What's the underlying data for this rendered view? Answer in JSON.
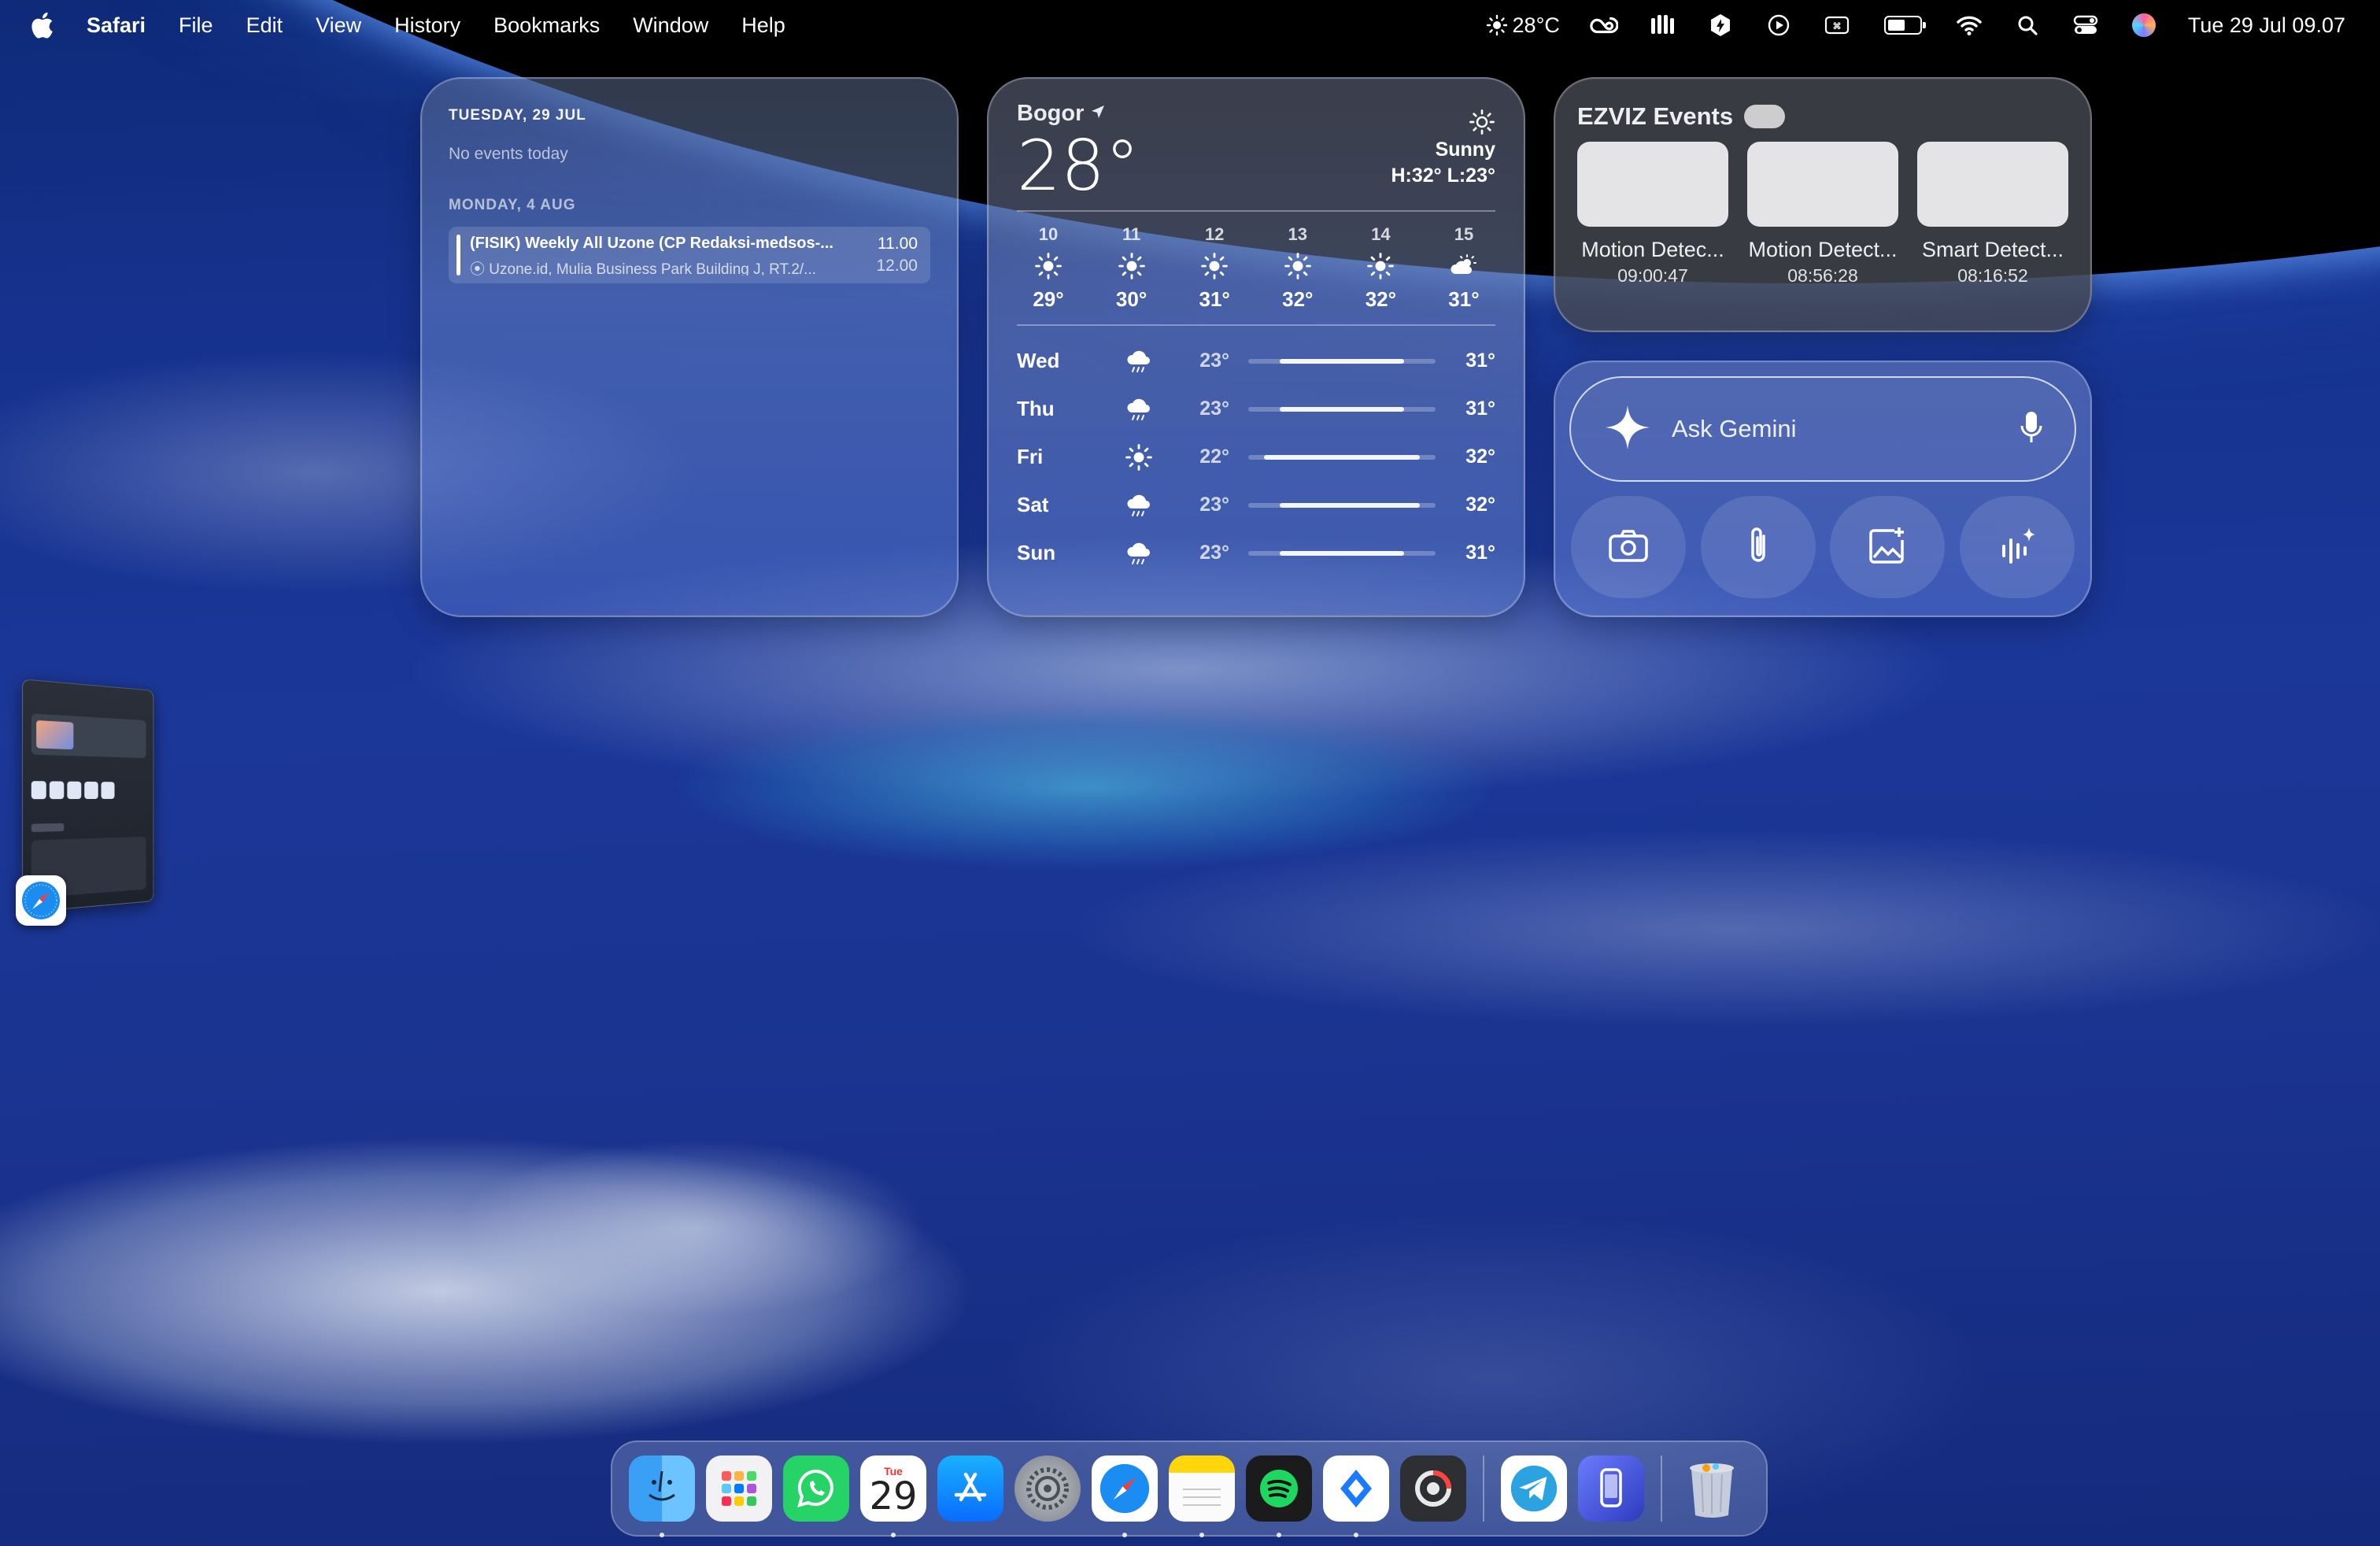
{
  "menubar": {
    "app_name": "Safari",
    "menus": [
      "File",
      "Edit",
      "View",
      "History",
      "Bookmarks",
      "Window",
      "Help"
    ],
    "weather": "28°C",
    "datetime": "Tue 29 Jul 09.07",
    "battery_level": 0.55,
    "status_icons": [
      "sun-icon",
      "creative-cloud-icon",
      "menu-app-icon",
      "vpn-icon",
      "play-icon",
      "input-source-icon",
      "battery-icon",
      "wifi-icon",
      "search-icon",
      "control-center-icon",
      "siri-icon"
    ]
  },
  "calendar": {
    "today_header": "TUESDAY, 29 JUL",
    "no_events": "No events today",
    "next_header": "MONDAY, 4 AUG",
    "event": {
      "title": "(FISIK) Weekly All Uzone (CP Redaksi-medsos-...",
      "location": "Uzone.id, Mulia Business Park Building J, RT.2/...",
      "start": "11.00",
      "end": "12.00"
    }
  },
  "weather": {
    "city": "Bogor",
    "temp": "28°",
    "condition": "Sunny",
    "high_low": "H:32° L:23°",
    "hourly": [
      {
        "hour": "10",
        "icon": "sun",
        "temp": "29°"
      },
      {
        "hour": "11",
        "icon": "sun",
        "temp": "30°"
      },
      {
        "hour": "12",
        "icon": "sun",
        "temp": "31°"
      },
      {
        "hour": "13",
        "icon": "sun",
        "temp": "32°"
      },
      {
        "hour": "14",
        "icon": "sun",
        "temp": "32°"
      },
      {
        "hour": "15",
        "icon": "partly-cloudy",
        "temp": "31°"
      }
    ],
    "daily": [
      {
        "day": "Wed",
        "icon": "rain",
        "low": "23°",
        "high": "31°"
      },
      {
        "day": "Thu",
        "icon": "rain",
        "low": "23°",
        "high": "31°"
      },
      {
        "day": "Fri",
        "icon": "sun",
        "low": "22°",
        "high": "32°"
      },
      {
        "day": "Sat",
        "icon": "rain",
        "low": "23°",
        "high": "32°"
      },
      {
        "day": "Sun",
        "icon": "rain",
        "low": "23°",
        "high": "31°"
      }
    ]
  },
  "ezviz": {
    "title": "EZVIZ Events",
    "events": [
      {
        "label": "Motion Detec...",
        "time": "09:00:47"
      },
      {
        "label": "Motion Detect...",
        "time": "08:56:28"
      },
      {
        "label": "Smart Detect...",
        "time": "08:16:52"
      }
    ]
  },
  "gemini": {
    "placeholder": "Ask Gemini",
    "actions": [
      "camera-icon",
      "attach-icon",
      "add-image-icon",
      "live-icon"
    ]
  },
  "dock": {
    "apps": [
      "Finder",
      "Launchpad",
      "WhatsApp",
      "Calendar",
      "App Store",
      "System Settings",
      "Safari",
      "Notes",
      "Spotify",
      "Looks",
      "Screen Recorder",
      "Telegram",
      "iPhone Mirroring",
      "Trash"
    ],
    "calendar_month": "Tue",
    "calendar_day": "29"
  }
}
